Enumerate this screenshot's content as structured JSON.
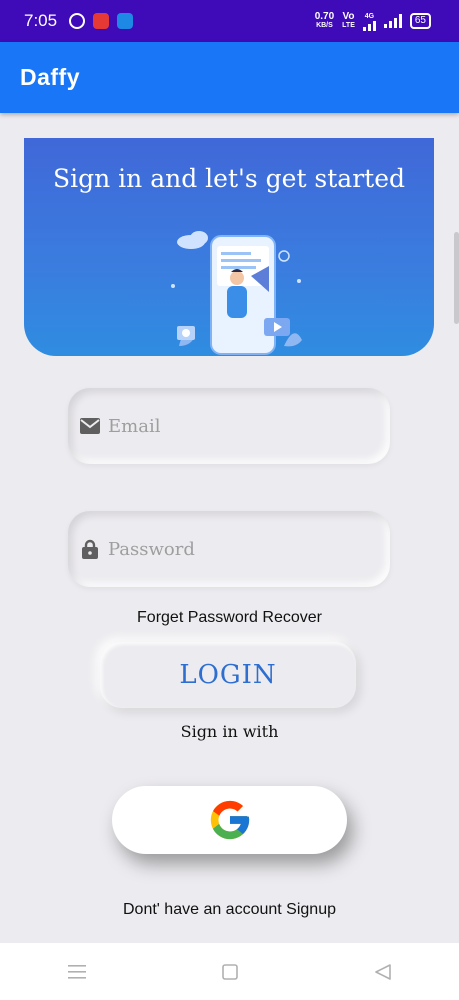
{
  "status_bar": {
    "time": "7:05",
    "net_speed_top": "0.70",
    "net_speed_bottom": "KB/S",
    "volte_top": "Vo",
    "volte_bottom": "LTE",
    "network": "4G",
    "battery": "65",
    "icons": [
      "whatsapp-icon",
      "red-app-icon",
      "blue-app-icon",
      "wifi-signal-icon",
      "signal-icon",
      "battery-icon"
    ]
  },
  "app_bar": {
    "title": "Daffy"
  },
  "banner": {
    "title": "Sign in and let's get started"
  },
  "email_field": {
    "placeholder": "Email",
    "value": "",
    "icon": "email-icon"
  },
  "password_field": {
    "placeholder": "Password",
    "value": "",
    "icon": "lock-icon"
  },
  "forget_link": "Forget Password Recover",
  "login_button": {
    "label": "LOGIN"
  },
  "sign_in_with": "Sign in with",
  "google_button": {
    "icon": "google-icon"
  },
  "signup_link": "Dont' have an account Signup",
  "nav_bar": {
    "icons": [
      "menu-icon",
      "home-icon",
      "back-icon"
    ]
  },
  "colors": {
    "status_bar": "#3f0bb8",
    "app_bar": "#1976f6",
    "background": "#ecebef",
    "login_text": "#2d6ed0"
  }
}
